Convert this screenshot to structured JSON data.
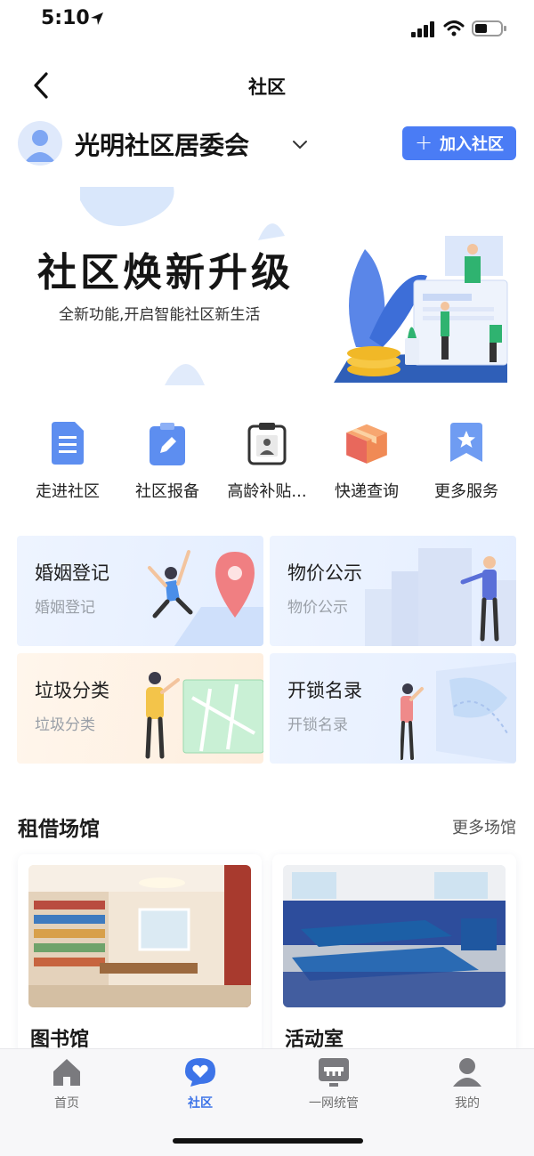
{
  "status_bar": {
    "time": "5:10"
  },
  "nav": {
    "title": "社区"
  },
  "community": {
    "name": "光明社区居委会",
    "join_label": "加入社区"
  },
  "banner": {
    "title": "社区焕新升级",
    "subtitle": "全新功能,开启智能社区新生活"
  },
  "services": [
    {
      "label": "走进社区",
      "icon": "document-icon"
    },
    {
      "label": "社区报备",
      "icon": "edit-clipboard-icon"
    },
    {
      "label": "高龄补贴...",
      "icon": "senior-clipboard-icon"
    },
    {
      "label": "快递查询",
      "icon": "package-icon"
    },
    {
      "label": "更多服务",
      "icon": "star-bookmark-icon"
    }
  ],
  "cards": [
    {
      "title": "婚姻登记",
      "subtitle": "婚姻登记"
    },
    {
      "title": "物价公示",
      "subtitle": "物价公示"
    },
    {
      "title": "垃圾分类",
      "subtitle": "垃圾分类"
    },
    {
      "title": "开锁名录",
      "subtitle": "开锁名录"
    }
  ],
  "venues": {
    "title": "租借场馆",
    "more": "更多场馆",
    "items": [
      {
        "name": "图书馆"
      },
      {
        "name": "活动室"
      }
    ]
  },
  "tabs": [
    {
      "label": "首页",
      "icon": "home-icon"
    },
    {
      "label": "社区",
      "icon": "heart-chat-icon",
      "active": true
    },
    {
      "label": "一网统管",
      "icon": "monitor-icon"
    },
    {
      "label": "我的",
      "icon": "user-icon"
    }
  ],
  "colors": {
    "accent": "#4a7cf5",
    "tab_active": "#3d74e8"
  }
}
